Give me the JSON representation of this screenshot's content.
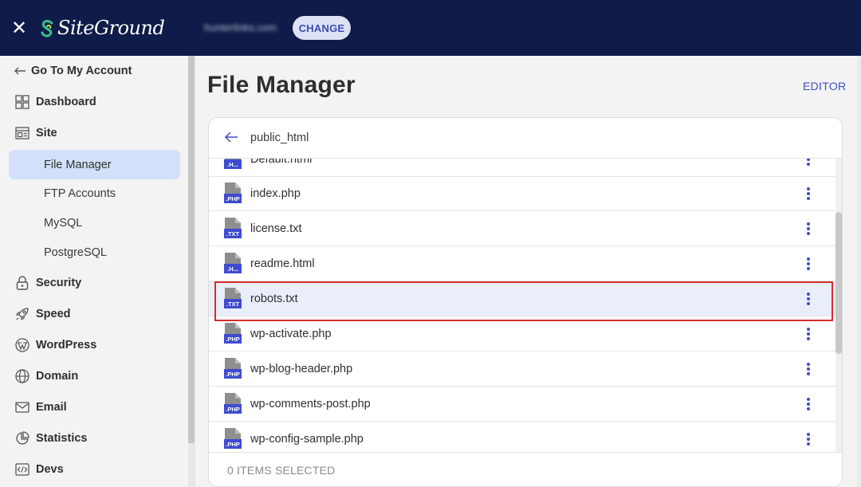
{
  "topbar": {
    "close_icon": "close-icon",
    "brand": "SiteGround",
    "domain": "hunterlinks.com",
    "change_label": "CHANGE"
  },
  "sidebar": {
    "back_label": "Go To My Account",
    "items": [
      {
        "label": "Dashboard",
        "icon": "grid-icon"
      },
      {
        "label": "Site",
        "icon": "site-icon"
      },
      {
        "label": "File Manager",
        "active": true
      },
      {
        "label": "FTP Accounts"
      },
      {
        "label": "MySQL"
      },
      {
        "label": "PostgreSQL"
      },
      {
        "label": "Security",
        "icon": "lock-icon"
      },
      {
        "label": "Speed",
        "icon": "rocket-icon"
      },
      {
        "label": "WordPress",
        "icon": "wordpress-icon"
      },
      {
        "label": "Domain",
        "icon": "globe-icon"
      },
      {
        "label": "Email",
        "icon": "envelope-icon"
      },
      {
        "label": "Statistics",
        "icon": "pie-chart-icon"
      },
      {
        "label": "Devs",
        "icon": "code-icon"
      }
    ]
  },
  "main": {
    "title": "File Manager",
    "editor_label": "EDITOR",
    "path": "public_html",
    "files": [
      {
        "name": "Default.html",
        "type": ".H..."
      },
      {
        "name": "index.php",
        "type": ".PHP"
      },
      {
        "name": "license.txt",
        "type": ".TXT"
      },
      {
        "name": "readme.html",
        "type": ".H..."
      },
      {
        "name": "robots.txt",
        "type": ".TXT",
        "selected": true
      },
      {
        "name": "wp-activate.php",
        "type": ".PHP"
      },
      {
        "name": "wp-blog-header.php",
        "type": ".PHP"
      },
      {
        "name": "wp-comments-post.php",
        "type": ".PHP"
      },
      {
        "name": "wp-config-sample.php",
        "type": ".PHP"
      }
    ],
    "footer": "0 ITEMS SELECTED"
  },
  "colors": {
    "topbar": "#0f1b48",
    "accent": "#3f4ec4",
    "highlight": "#d62c2c",
    "active_nav": "#d2e1f9",
    "file_icon_badge": "#3e4bd0"
  }
}
